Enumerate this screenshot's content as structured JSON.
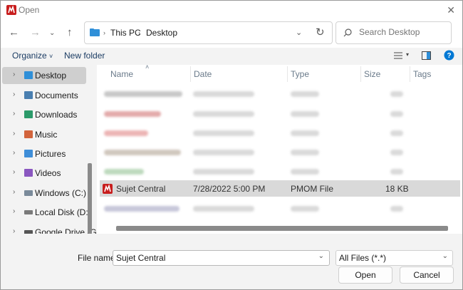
{
  "window": {
    "title": "Open"
  },
  "address": {
    "segments": [
      "This PC",
      "Desktop"
    ]
  },
  "search": {
    "placeholder": "Search Desktop"
  },
  "commands": {
    "organize": "Organize",
    "new_folder": "New folder"
  },
  "sidebar": {
    "items": [
      {
        "label": "Desktop",
        "icon": "desktop-icon",
        "color": "#2f8fd8"
      },
      {
        "label": "Documents",
        "icon": "documents-icon",
        "color": "#4a7fb0"
      },
      {
        "label": "Downloads",
        "icon": "downloads-icon",
        "color": "#2c9a6a"
      },
      {
        "label": "Music",
        "icon": "music-icon",
        "color": "#d2643c"
      },
      {
        "label": "Pictures",
        "icon": "pictures-icon",
        "color": "#3f8ed8"
      },
      {
        "label": "Videos",
        "icon": "videos-icon",
        "color": "#8a57c0"
      },
      {
        "label": "Windows (C:)",
        "icon": "drive-icon",
        "color": "#7a8a9a"
      },
      {
        "label": "Local Disk (D:)",
        "icon": "drive-icon",
        "color": "#7a7a7a"
      },
      {
        "label": "Google Drive (G",
        "icon": "drive-icon",
        "color": "#555555"
      }
    ]
  },
  "columns": {
    "name": "Name",
    "date": "Date",
    "type": "Type",
    "size": "Size",
    "tags": "Tags"
  },
  "files": {
    "selected": {
      "name": "Sujet Central",
      "date": "7/28/2022 5:00 PM",
      "type": "PMOM File",
      "size": "18 KB"
    }
  },
  "footer": {
    "filename_label": "File name:",
    "filename_value": "Sujet Central",
    "filetype_value": "All Files (*.*)",
    "open_label": "Open",
    "cancel_label": "Cancel"
  },
  "colors": {
    "accent": "#0078d4",
    "app_red": "#c81e1e",
    "selection": "#d9d9d9"
  }
}
